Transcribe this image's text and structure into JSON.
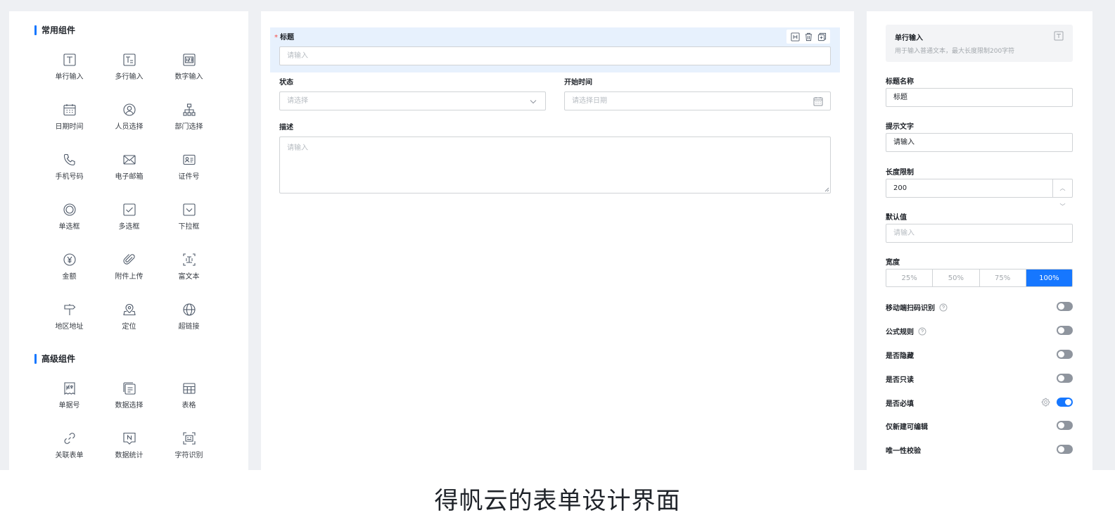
{
  "palette": {
    "common_title": "常用组件",
    "advanced_title": "高级组件",
    "common": [
      {
        "label": "单行输入",
        "icon": "text-t-icon"
      },
      {
        "label": "多行输入",
        "icon": "multiline-text-icon"
      },
      {
        "label": "数字输入",
        "icon": "number-123-icon"
      },
      {
        "label": "日期时间",
        "icon": "calendar-icon"
      },
      {
        "label": "人员选择",
        "icon": "user-icon"
      },
      {
        "label": "部门选择",
        "icon": "org-tree-icon"
      },
      {
        "label": "手机号码",
        "icon": "phone-icon"
      },
      {
        "label": "电子邮箱",
        "icon": "mail-icon"
      },
      {
        "label": "证件号",
        "icon": "id-card-icon"
      },
      {
        "label": "单选框",
        "icon": "radio-icon"
      },
      {
        "label": "多选框",
        "icon": "checkbox-icon"
      },
      {
        "label": "下拉框",
        "icon": "dropdown-icon"
      },
      {
        "label": "金额",
        "icon": "yen-icon"
      },
      {
        "label": "附件上传",
        "icon": "paperclip-icon"
      },
      {
        "label": "富文本",
        "icon": "rich-text-icon"
      },
      {
        "label": "地区地址",
        "icon": "signpost-icon"
      },
      {
        "label": "定位",
        "icon": "location-icon"
      },
      {
        "label": "超链接",
        "icon": "globe-icon"
      }
    ],
    "advanced": [
      {
        "label": "单据号",
        "icon": "serial-no-icon"
      },
      {
        "label": "数据选择",
        "icon": "data-select-icon"
      },
      {
        "label": "表格",
        "icon": "table-icon"
      },
      {
        "label": "关联表单",
        "icon": "link-icon"
      },
      {
        "label": "数据统计",
        "icon": "statistics-icon"
      },
      {
        "label": "字符识别",
        "icon": "scan-text-icon"
      }
    ]
  },
  "canvas": {
    "title_field": {
      "label": "标题",
      "required_mark": "*",
      "placeholder": "请输入"
    },
    "status_field": {
      "label": "状态",
      "placeholder": "请选择"
    },
    "start_time_field": {
      "label": "开始时间",
      "placeholder": "请选择日期"
    },
    "description_field": {
      "label": "描述",
      "placeholder": "请输入"
    }
  },
  "properties": {
    "component_name": "单行输入",
    "component_desc": "用于输入普通文本，最大长度限制200字符",
    "title_name_label": "标题名称",
    "title_name_value": "标题",
    "hint_label": "提示文字",
    "hint_value": "请输入",
    "length_label": "长度限制",
    "length_value": "200",
    "default_label": "默认值",
    "default_placeholder": "请输入",
    "width_label": "宽度",
    "width_options": [
      "25%",
      "50%",
      "75%",
      "100%"
    ],
    "width_selected": "100%",
    "toggles": [
      {
        "label": "移动端扫码识别",
        "help": true,
        "on": false
      },
      {
        "label": "公式规则",
        "help": true,
        "on": false
      },
      {
        "label": "是否隐藏",
        "help": false,
        "on": false
      },
      {
        "label": "是否只读",
        "help": false,
        "on": false
      },
      {
        "label": "是否必填",
        "help": false,
        "on": true,
        "gear": true
      },
      {
        "label": "仅新建可编辑",
        "help": false,
        "on": false
      },
      {
        "label": "唯一性校验",
        "help": false,
        "on": false
      }
    ]
  },
  "caption": "得帆云的表单设计界面",
  "colors": {
    "accent": "#1677ff",
    "selected_bg": "#e7f1fd",
    "required": "#f54a45"
  }
}
